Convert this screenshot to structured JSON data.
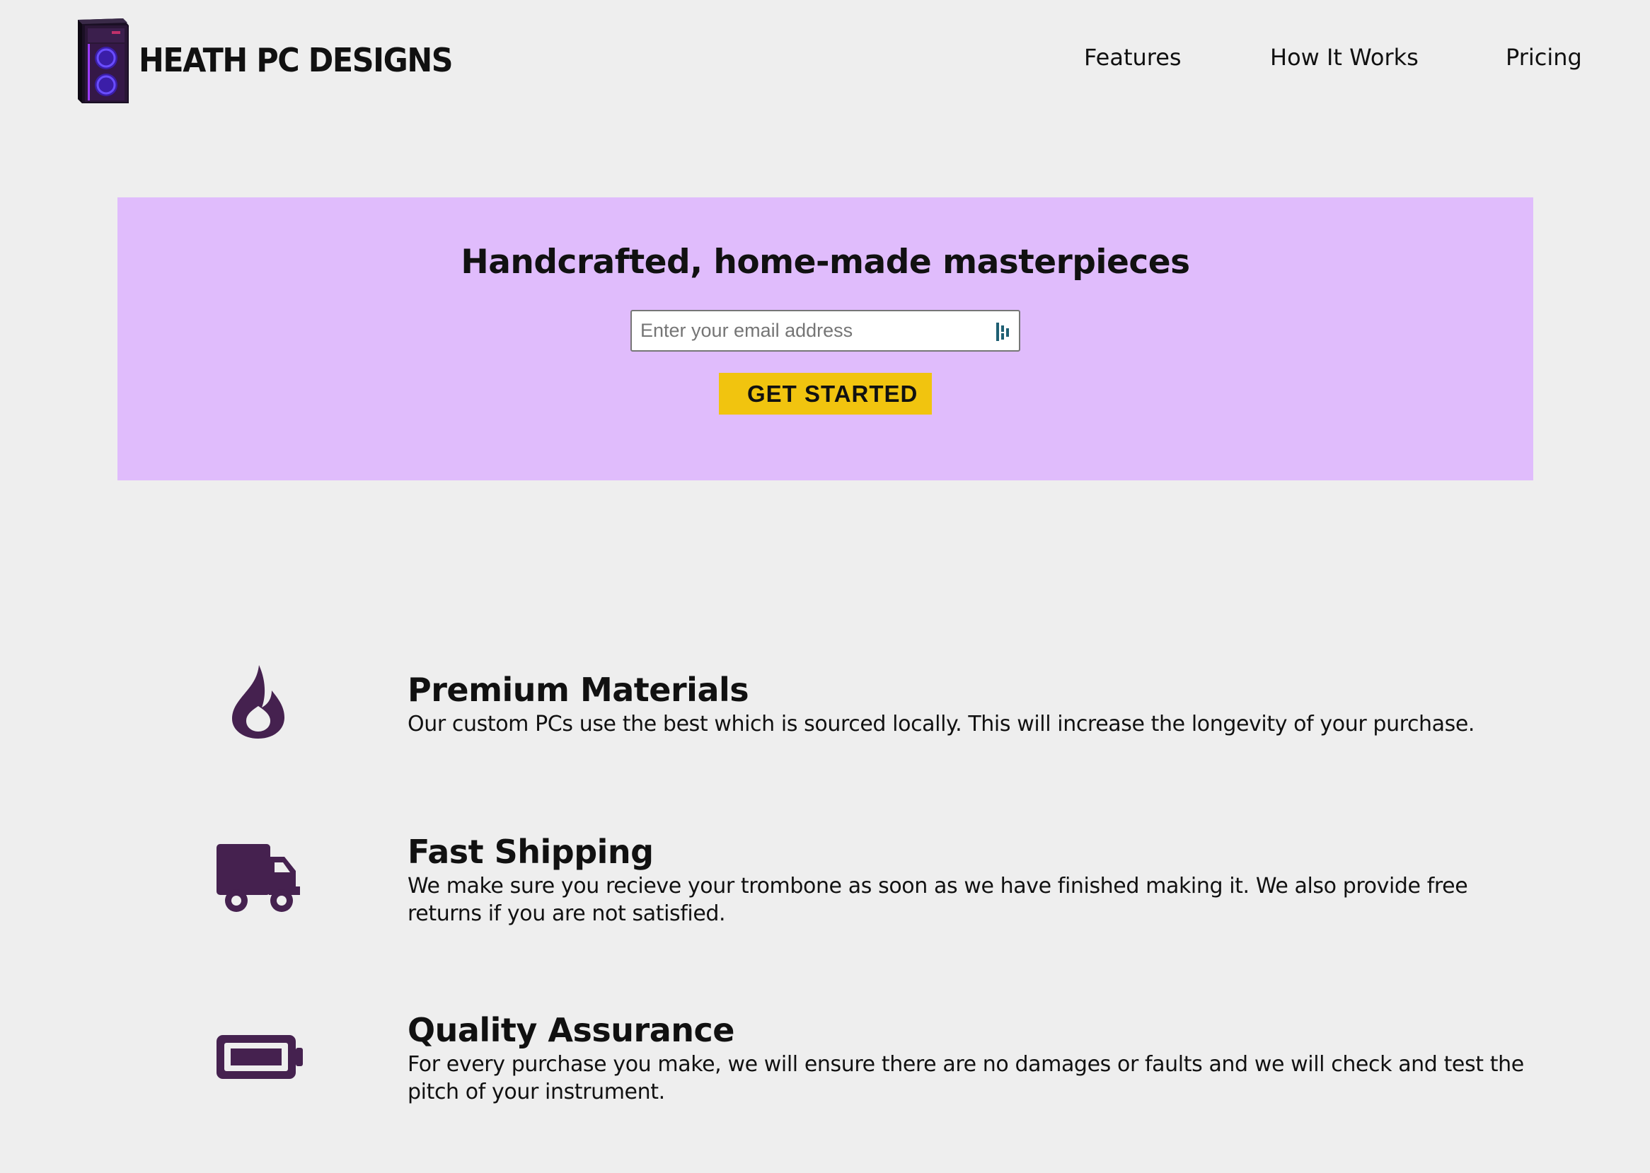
{
  "header": {
    "brand": "HEATH PC DESIGNS",
    "logo_icon": "pc-tower-logo",
    "nav": [
      {
        "label": "Features"
      },
      {
        "label": "How It Works"
      },
      {
        "label": "Pricing"
      }
    ]
  },
  "hero": {
    "title": "Handcrafted, home-made masterpieces",
    "email": {
      "placeholder": "Enter your email address",
      "value": ""
    },
    "cta_label": "GET STARTED"
  },
  "features": [
    {
      "icon": "fire-icon",
      "title": "Premium Materials",
      "description": "Our custom PCs use the best which is sourced locally. This will increase the longevity of your purchase."
    },
    {
      "icon": "truck-icon",
      "title": "Fast Shipping",
      "description": "We make sure you recieve your trombone as soon as we have finished making it. We also provide free returns if you are not satisfied."
    },
    {
      "icon": "battery-icon",
      "title": "Quality Assurance",
      "description": "For every purchase you make, we will ensure there are no damages or faults and we will check and test the pitch of your instrument."
    }
  ],
  "colors": {
    "page_background": "#eeeeee",
    "hero_background": "#e0bcfc",
    "cta_background": "#f1c40f",
    "icon_color": "#45214f",
    "text": "#111111"
  }
}
